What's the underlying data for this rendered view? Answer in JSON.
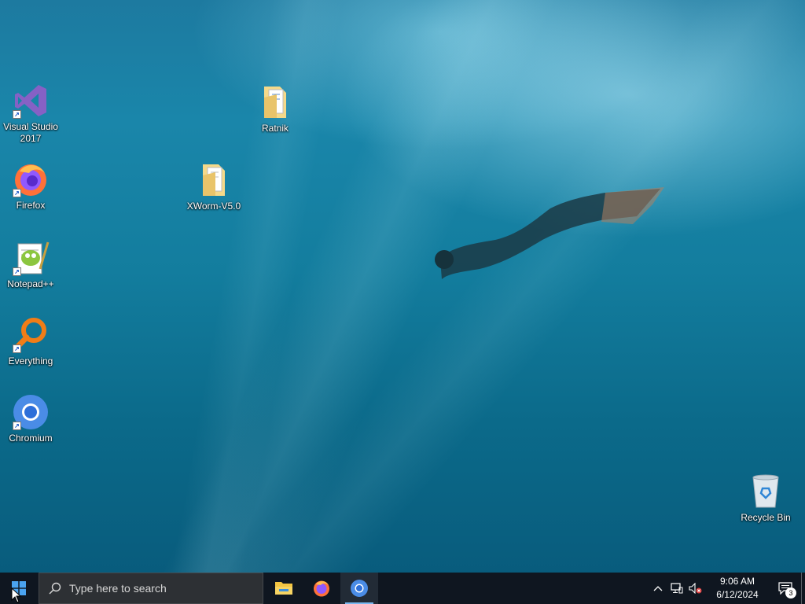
{
  "desktop": {
    "icons": [
      {
        "label": "Visual Studio 2017",
        "icon": "visual-studio-icon",
        "shortcut": true
      },
      {
        "label": "Firefox",
        "icon": "firefox-icon",
        "shortcut": true
      },
      {
        "label": "Notepad++",
        "icon": "notepadpp-icon",
        "shortcut": true
      },
      {
        "label": "Everything",
        "icon": "everything-icon",
        "shortcut": true
      },
      {
        "label": "Chromium",
        "icon": "chromium-icon",
        "shortcut": true
      },
      {
        "label": "Ratnik",
        "icon": "folder-icon",
        "shortcut": false
      },
      {
        "label": "XWorm-V5.0",
        "icon": "folder-icon",
        "shortcut": false
      },
      {
        "label": "Recycle Bin",
        "icon": "recycle-bin-icon",
        "shortcut": false
      }
    ]
  },
  "taskbar": {
    "start_icon": "windows-logo-icon",
    "search": {
      "placeholder": "Type here to search",
      "icon": "search-icon"
    },
    "pinned": [
      {
        "name": "File Explorer",
        "icon": "file-explorer-icon",
        "active": false
      },
      {
        "name": "Firefox",
        "icon": "firefox-icon",
        "active": false
      },
      {
        "name": "Chromium",
        "icon": "chromium-icon",
        "active": true
      }
    ],
    "tray": {
      "icons": [
        "chevron-up-icon",
        "network-icon",
        "volume-muted-icon"
      ],
      "time": "9:06 AM",
      "date": "6/12/2024",
      "notification_count": "3"
    }
  },
  "colors": {
    "taskbar_bg": "#0f1620",
    "search_bg": "#2d3034",
    "accent": "#79b8f0",
    "wallpaper": "#137d9e"
  }
}
